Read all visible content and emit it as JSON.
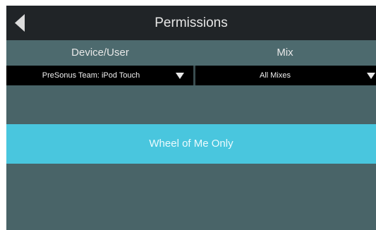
{
  "header": {
    "title": "Permissions",
    "back_icon": "back-arrow-icon"
  },
  "columns": {
    "device_label": "Device/User",
    "mix_label": "Mix"
  },
  "selectors": {
    "device_value": "PreSonus Team: iPod Touch",
    "mix_value": "All Mixes",
    "dropdown_icon": "dropdown-triangle-icon"
  },
  "permission_option": {
    "label": "Wheel of Me Only"
  },
  "colors": {
    "titlebar": "#202427",
    "panel": "#496468",
    "accent": "#49c6de",
    "selector": "#000000"
  }
}
